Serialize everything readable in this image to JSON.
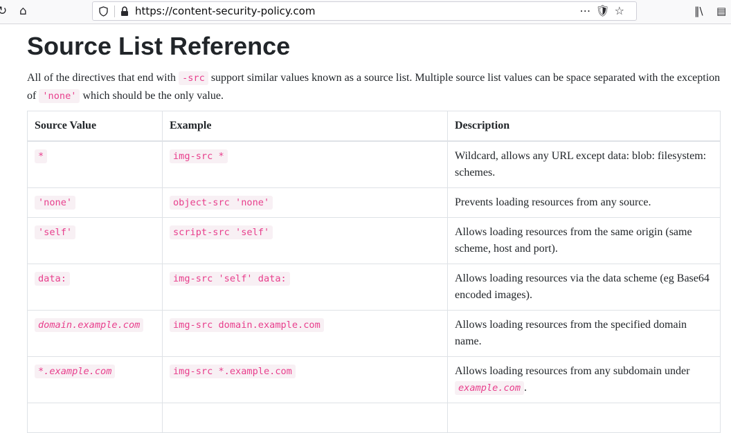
{
  "browser": {
    "url": "https://content-security-policy.com",
    "reload_icon": "reload-icon",
    "home_icon": "home-icon",
    "page_actions_icon": "ellipsis-icon",
    "pocket_icon": "pocket-icon",
    "bookmark_icon": "star-icon",
    "library_icon": "library-icon",
    "sidebar_icon": "sidebar-icon"
  },
  "page": {
    "title": "Source List Reference",
    "intro": {
      "part1": "All of the directives that end with ",
      "code1": "-src",
      "part2": " support similar values known as a source list. Multiple source list values can be space separated with the exception of ",
      "code2": "'none'",
      "part3": " which should be the only value."
    }
  },
  "table": {
    "headers": [
      "Source Value",
      "Example",
      "Description"
    ],
    "rows": [
      {
        "source": "*",
        "example": "img-src *",
        "description": "Wildcard, allows any URL except data: blob: filesystem: schemes."
      },
      {
        "source": "'none'",
        "example": "object-src 'none'",
        "description": "Prevents loading resources from any source."
      },
      {
        "source": "'self'",
        "example": "script-src 'self'",
        "description": "Allows loading resources from the same origin (same scheme, host and port)."
      },
      {
        "source": "data:",
        "example": "img-src 'self' data:",
        "description": "Allows loading resources via the data scheme (eg Base64 encoded images)."
      },
      {
        "source": "domain.example.com",
        "example": "img-src domain.example.com",
        "description": "Allows loading resources from the specified domain name."
      },
      {
        "source": "*.example.com",
        "example": "img-src *.example.com",
        "description": "Allows loading resources from any subdomain under",
        "description_code": "example.com",
        "description_end": "."
      }
    ]
  },
  "colors": {
    "code_text": "#e83e8c",
    "code_bg": "#f8f0f4",
    "border": "#dee2e6",
    "text": "#212529"
  }
}
